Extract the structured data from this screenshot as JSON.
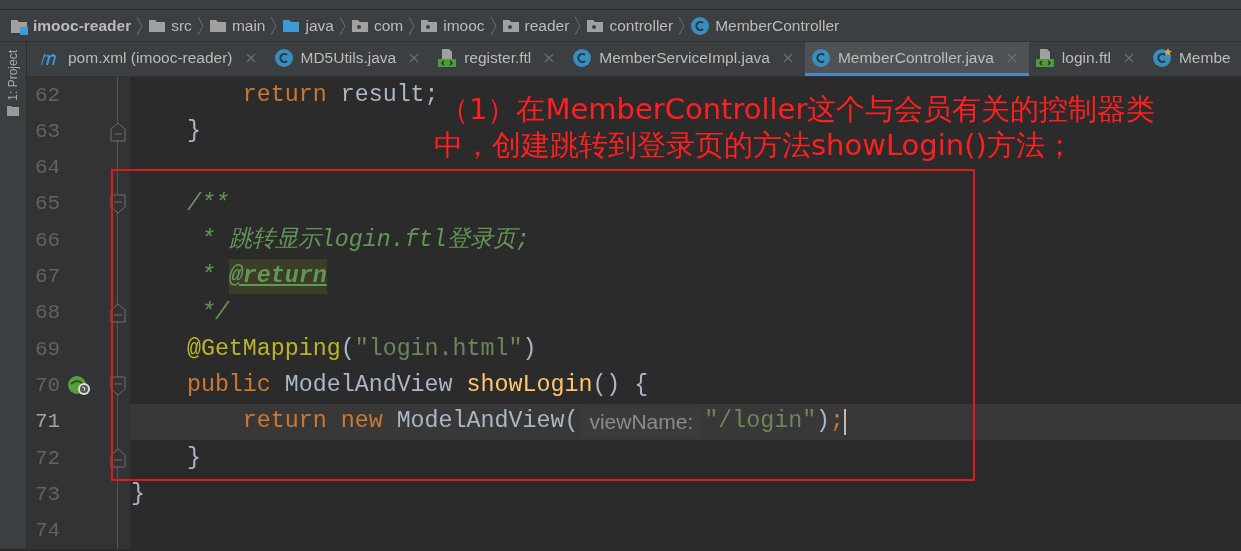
{
  "breadcrumbs": [
    {
      "label": "imooc-reader",
      "kind": "module"
    },
    {
      "label": "src",
      "kind": "folder"
    },
    {
      "label": "main",
      "kind": "folder"
    },
    {
      "label": "java",
      "kind": "source-folder"
    },
    {
      "label": "com",
      "kind": "package"
    },
    {
      "label": "imooc",
      "kind": "package"
    },
    {
      "label": "reader",
      "kind": "package"
    },
    {
      "label": "controller",
      "kind": "package"
    },
    {
      "label": "MemberController",
      "kind": "class"
    }
  ],
  "side_panel": {
    "label": "1: Project"
  },
  "tabs": [
    {
      "label": "pom.xml (imooc-reader)",
      "kind": "maven",
      "selected": false,
      "closable": true
    },
    {
      "label": "MD5Utils.java",
      "kind": "class",
      "selected": false,
      "closable": true
    },
    {
      "label": "register.ftl",
      "kind": "template",
      "selected": false,
      "closable": true
    },
    {
      "label": "MemberServiceImpl.java",
      "kind": "class",
      "selected": false,
      "closable": true
    },
    {
      "label": "MemberController.java",
      "kind": "class",
      "selected": true,
      "closable": true
    },
    {
      "label": "login.ftl",
      "kind": "template",
      "selected": false,
      "closable": true
    },
    {
      "label": "Membe",
      "kind": "class-modified",
      "selected": false,
      "closable": false
    }
  ],
  "editor": {
    "lines": [
      {
        "number": "62",
        "kind": "plain",
        "tokens": [
          {
            "kind": "keyword",
            "text": "        return"
          },
          {
            "kind": "plain",
            "text": " result;"
          }
        ]
      },
      {
        "number": "63",
        "kind": "fold-end",
        "tokens": [
          {
            "kind": "plain",
            "text": "    }"
          }
        ]
      },
      {
        "number": "64",
        "kind": "plain"
      },
      {
        "number": "65",
        "kind": "fold-start",
        "tokens": [
          {
            "kind": "doc",
            "text": "    /**"
          }
        ]
      },
      {
        "number": "66",
        "kind": "plain",
        "tokens": [
          {
            "kind": "doc",
            "text": "     * 跳转显示login.ftl登录页;"
          }
        ]
      },
      {
        "number": "67",
        "kind": "plain",
        "tokens": [
          {
            "kind": "doc",
            "text": "     * "
          },
          {
            "kind": "doctag",
            "text": "@return"
          }
        ]
      },
      {
        "number": "68",
        "kind": "fold-end",
        "tokens": [
          {
            "kind": "doc",
            "text": "     */"
          }
        ]
      },
      {
        "number": "69",
        "kind": "plain",
        "tokens": [
          {
            "kind": "annotation",
            "text": "    @GetMapping"
          },
          {
            "kind": "plain",
            "text": "("
          },
          {
            "kind": "string",
            "text": "\"login.html\""
          },
          {
            "kind": "plain",
            "text": ")"
          }
        ]
      },
      {
        "number": "70",
        "kind": "method-start",
        "tokens": [
          {
            "kind": "keyword",
            "text": "    public"
          },
          {
            "kind": "plain",
            "text": " ModelAndView "
          },
          {
            "kind": "method",
            "text": "showLogin"
          },
          {
            "kind": "plain",
            "text": "() {"
          }
        ]
      },
      {
        "number": "71",
        "kind": "plain",
        "current": true,
        "caret": true,
        "tokens": [
          {
            "kind": "keyword",
            "text": "        return new"
          },
          {
            "kind": "plain",
            "text": " ModelAndView("
          },
          {
            "kind": "hint",
            "text": "viewName:"
          },
          {
            "kind": "string",
            "text": "\"/login\""
          },
          {
            "kind": "plain",
            "text": ")"
          },
          {
            "kind": "keyword",
            "text": ";"
          }
        ]
      },
      {
        "number": "72",
        "kind": "fold-end",
        "tokens": [
          {
            "kind": "plain",
            "text": "    }"
          }
        ]
      },
      {
        "number": "73",
        "kind": "plain",
        "tokens": [
          {
            "kind": "plain",
            "text": "}"
          }
        ]
      },
      {
        "number": "74",
        "kind": "plain"
      }
    ]
  },
  "annotation": {
    "lines": [
      "（1）在MemberController这个与会员有关的控制器类",
      "中，创建跳转到登录页的方法showLogin()方法；"
    ]
  }
}
